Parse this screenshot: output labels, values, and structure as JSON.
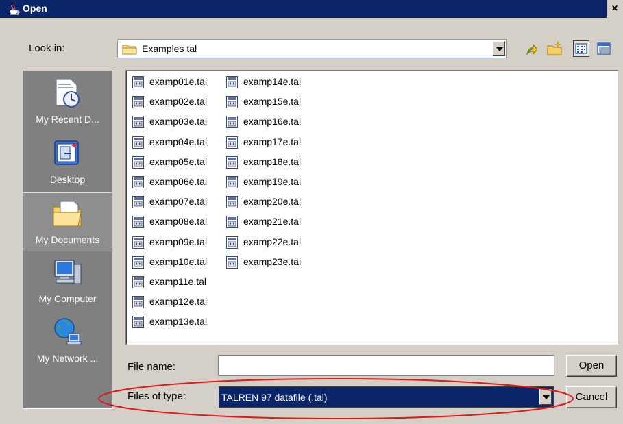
{
  "window": {
    "title": "Open",
    "close_glyph": "×"
  },
  "toolbar": {
    "look_in_label": "Look in:",
    "look_in_value": "Examples tal",
    "buttons": [
      {
        "icon": "up-one-level-icon"
      },
      {
        "icon": "create-new-folder-icon"
      },
      {
        "icon": "list-view-icon",
        "selected": true
      },
      {
        "icon": "details-view-icon"
      }
    ]
  },
  "places": [
    {
      "label": "My Recent D...",
      "icon": "recent-documents-icon"
    },
    {
      "label": "Desktop",
      "icon": "desktop-icon"
    },
    {
      "label": "My Documents",
      "icon": "my-documents-icon",
      "selected": true
    },
    {
      "label": "My Computer",
      "icon": "my-computer-icon"
    },
    {
      "label": "My Network ...",
      "icon": "my-network-icon"
    }
  ],
  "files": {
    "column1": [
      "examp01e.tal",
      "examp02e.tal",
      "examp03e.tal",
      "examp04e.tal",
      "examp05e.tal",
      "examp06e.tal",
      "examp07e.tal",
      "examp08e.tal",
      "examp09e.tal",
      "examp10e.tal",
      "examp11e.tal",
      "examp12e.tal",
      "examp13e.tal"
    ],
    "column2": [
      "examp14e.tal",
      "examp15e.tal",
      "examp16e.tal",
      "examp17e.tal",
      "examp18e.tal",
      "examp19e.tal",
      "examp20e.tal",
      "examp21e.tal",
      "examp22e.tal",
      "examp23e.tal"
    ]
  },
  "form": {
    "file_name_label": "File name:",
    "file_name_value": "",
    "files_of_type_label": "Files of type:",
    "files_of_type_value": "TALREN 97 datafile (.tal)"
  },
  "buttons": {
    "open_label": "Open",
    "cancel_label": "Cancel"
  },
  "colors": {
    "titlebar": "#0a246a",
    "dialog_bg": "#d4d0c8",
    "places_bg": "#808080",
    "annotation": "#e01818"
  }
}
